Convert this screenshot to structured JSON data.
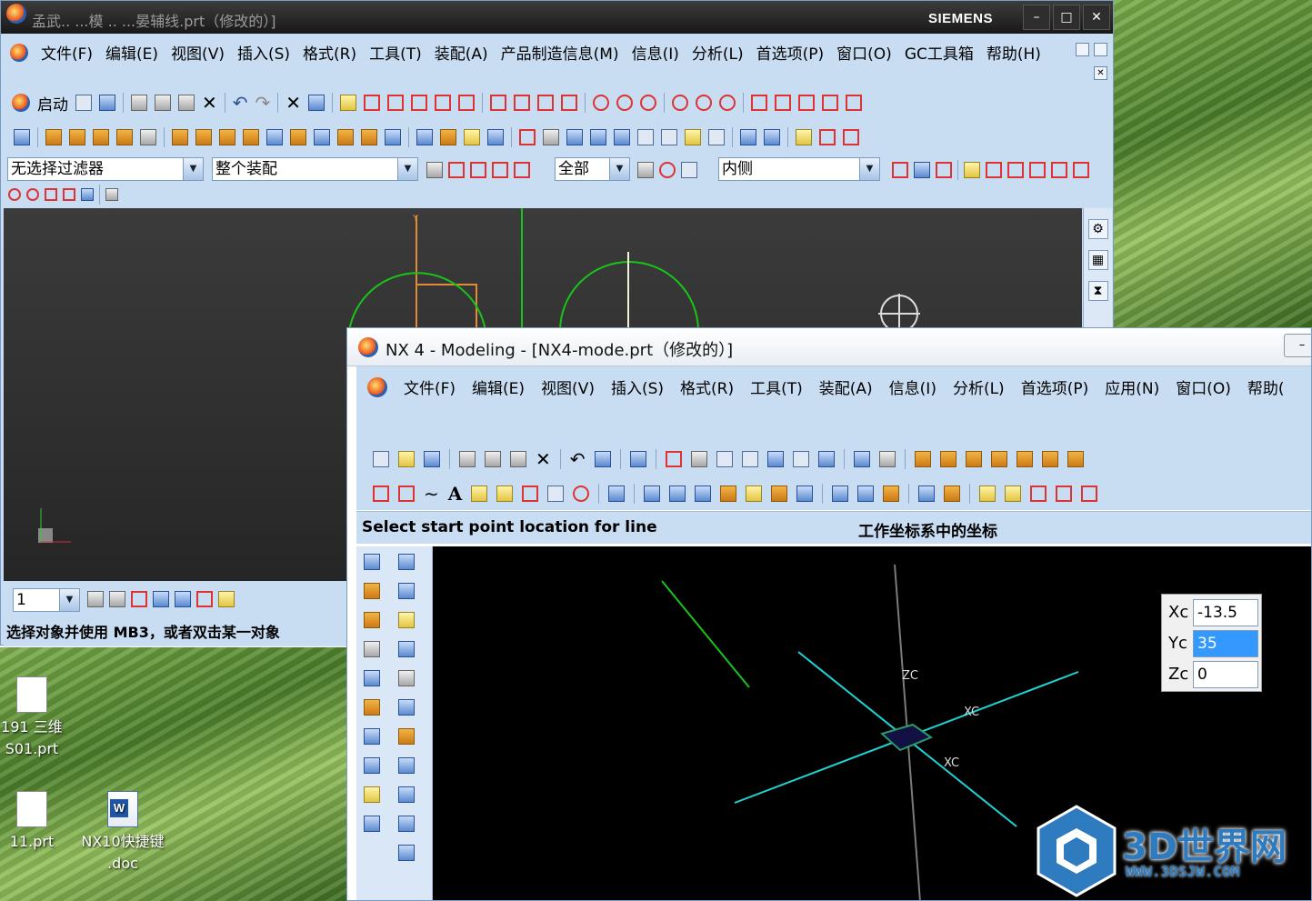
{
  "back_window": {
    "title": "孟武..  ...模 ..  ...晏辅线.prt（修改的）]",
    "brand": "SIEMENS",
    "menu": [
      "文件(F)",
      "编辑(E)",
      "视图(V)",
      "插入(S)",
      "格式(R)",
      "工具(T)",
      "装配(A)",
      "产品制造信息(M)",
      "信息(I)",
      "分析(L)",
      "首选项(P)",
      "窗口(O)",
      "GC工具箱",
      "帮助(H)"
    ],
    "start_label": "启动",
    "filter_combo": "无选择过滤器",
    "scope_combo": "整个装配",
    "all_combo": "全部",
    "inside_combo": "内侧",
    "layer_combo": "1",
    "status": "选择对象并使用 MB3，或者双击某一对象",
    "axis_y": "Y"
  },
  "front_window": {
    "title": "NX 4 - Modeling - [NX4-mode.prt（修改的）]",
    "menu": [
      "文件(F)",
      "编辑(E)",
      "视图(V)",
      "插入(S)",
      "格式(R)",
      "工具(T)",
      "装配(A)",
      "信息(I)",
      "分析(L)",
      "首选项(P)",
      "应用(N)",
      "窗口(O)",
      "帮助("
    ],
    "cue": "Select start point location for line",
    "coord_label": "工作坐标系中的坐标",
    "axis_labels": {
      "zc": "ZC",
      "xc1": "XC",
      "xc2": "XC"
    },
    "coords": {
      "xc_label": "Xc",
      "xc_value": "-13.5",
      "yc_label": "Yc",
      "yc_value": "35",
      "zc_label": "Zc",
      "zc_value": "0"
    }
  },
  "desktop": {
    "icons": [
      {
        "label": "191 三维\nS01.prt",
        "kind": "prt"
      },
      {
        "label": "11.prt",
        "kind": "prt"
      },
      {
        "label": "NX10快捷键\n.doc",
        "kind": "doc"
      }
    ]
  },
  "watermark": {
    "cn": "3D世界网",
    "url": "WWW.3DSJW.COM"
  },
  "colors": {
    "ui_blue": "#c8ddf2",
    "viewport": "#2d2d2d",
    "cyan_axis": "#1fd3d3",
    "green_line": "#19c419",
    "orange_wcs": "#e38a35"
  }
}
